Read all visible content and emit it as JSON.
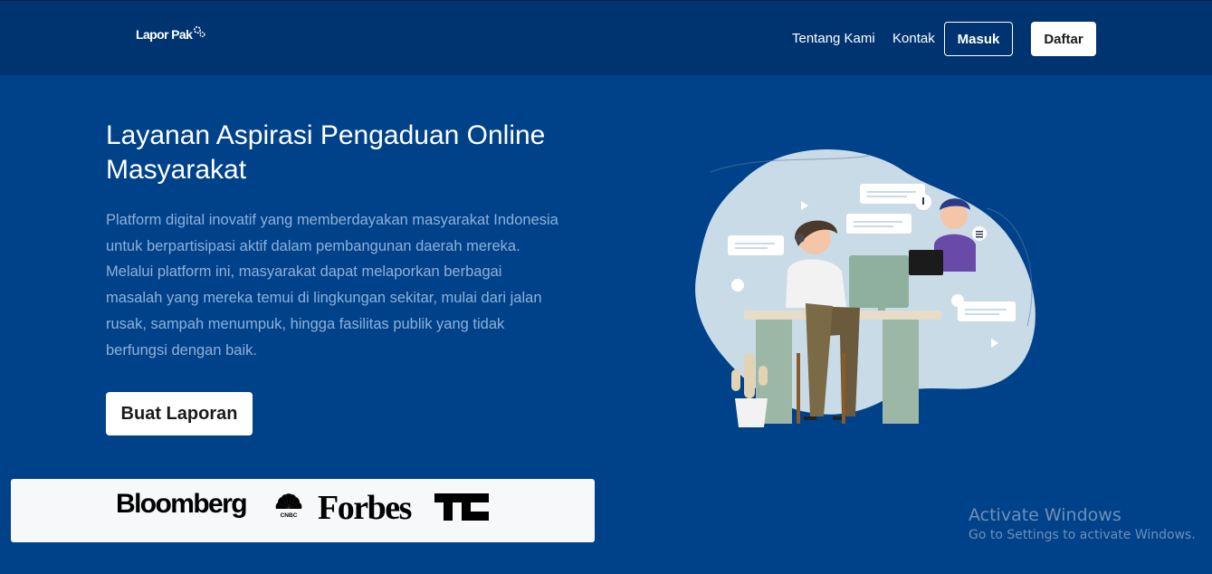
{
  "navbar": {
    "logo_text": "Lapor Pak",
    "links": [
      "Tentang Kami",
      "Kontak"
    ],
    "login_label": "Masuk",
    "register_label": "Daftar"
  },
  "hero": {
    "title": "Layanan Aspirasi Pengaduan Online Masyarakat",
    "description": "Platform digital inovatif yang memberdayakan masyarakat Indonesia untuk berpartisipasi aktif dalam pembangunan daerah mereka. Melalui platform ini, masyarakat dapat melaporkan berbagai masalah yang mereka temui di lingkungan sekitar, mulai dari jalan rusak, sampah menumpuk, hingga fasilitas publik yang tidak berfungsi dengan baik.",
    "cta_label": "Buat Laporan"
  },
  "press": {
    "logos": [
      "Bloomberg",
      "CNBC",
      "Forbes",
      "TC"
    ]
  },
  "watermark": {
    "title": "Activate Windows",
    "subtitle": "Go to Settings to activate Windows."
  },
  "colors": {
    "background": "#00428a",
    "navbar": "#003470",
    "description_text": "#8fb0d8"
  }
}
